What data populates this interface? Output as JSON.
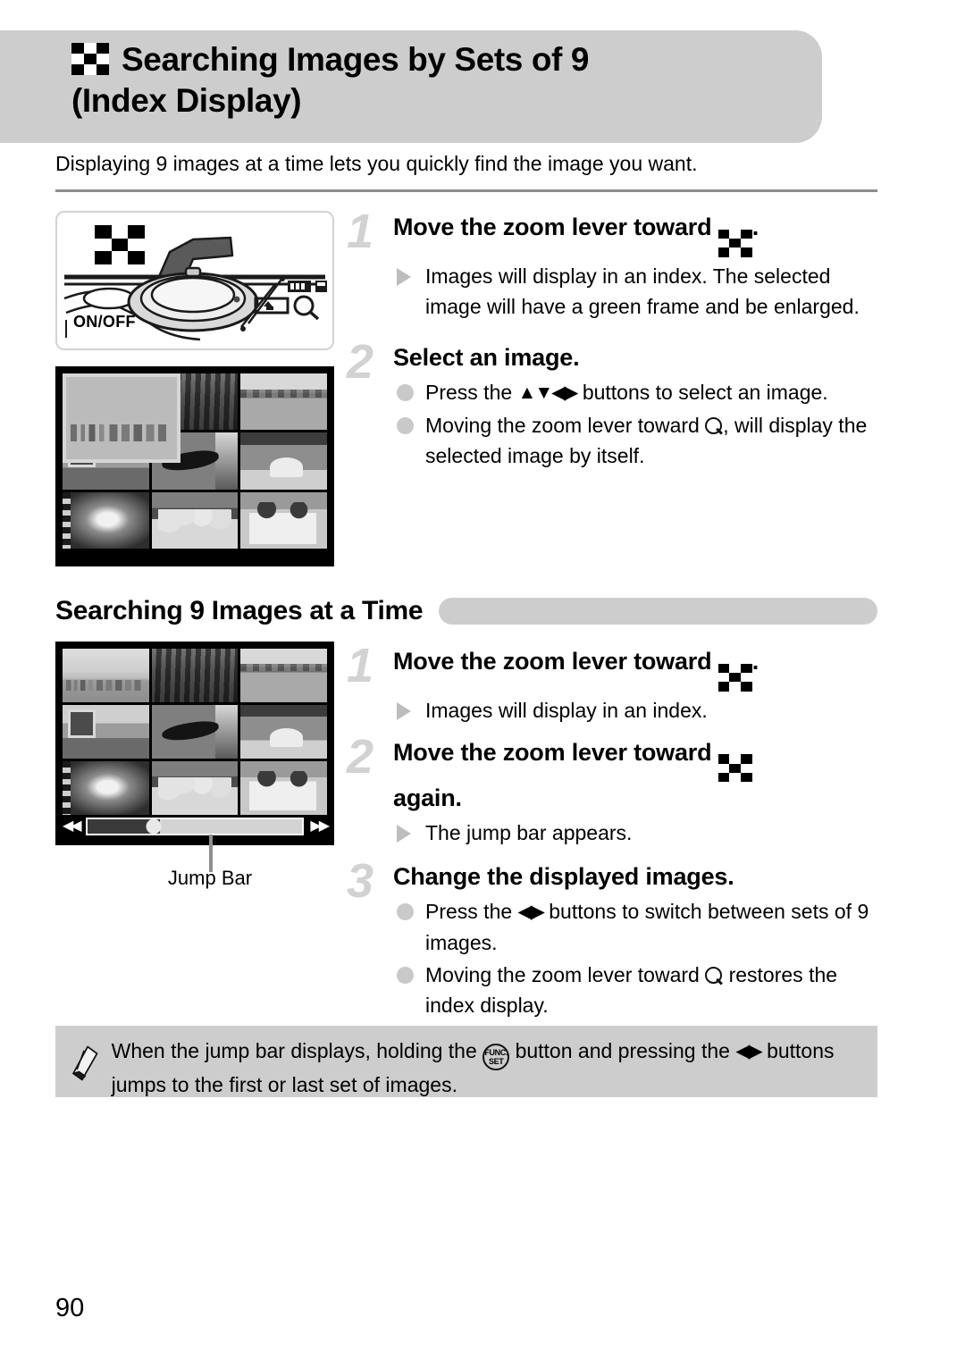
{
  "header": {
    "icon": "checkerboard-index-icon",
    "title_line1": "Searching Images by Sets of 9",
    "title_line2": "(Index Display)",
    "band_color": "#cdcdcd"
  },
  "intro": "Displaying 9 images at a time lets you quickly find the image you want.",
  "camera_figure": {
    "name": "camera-top-zoom-lever-illustration",
    "onoff_label": "ON/OFF",
    "icons": [
      "checkerboard-index-icon",
      "arrow-icon",
      "zoom-lever-icon",
      "magnifier-icon",
      "wide-icon",
      "tele-icon"
    ]
  },
  "index_display_1": {
    "name": "index-display-9-images",
    "selected_index": 0,
    "thumbnails": [
      "city-skyline",
      "forest-path",
      "lake-shore",
      "museum-room",
      "hammock",
      "dining-room",
      "dog-film",
      "girls-group",
      "family-portrait"
    ]
  },
  "steps_top": [
    {
      "number": "1",
      "heading_before": "Move the zoom lever toward",
      "heading_icon": "checkerboard-index-icon",
      "heading_after": ".",
      "bullets": [
        {
          "marker": "triangle",
          "text": "Images will display in an index. The selected image will have a green frame and be enlarged."
        }
      ]
    },
    {
      "number": "2",
      "heading_before": "Select an image.",
      "heading_icon": "",
      "heading_after": "",
      "bullets": [
        {
          "marker": "dot",
          "text_before": "Press the",
          "icon": "updown-leftright-arrows",
          "text_after": "buttons to select an image."
        },
        {
          "marker": "dot",
          "text_before": "Moving the zoom lever toward",
          "icon": "magnifier-icon",
          "text_after": ", will display the selected image by itself."
        }
      ]
    }
  ],
  "section": {
    "title": "Searching 9 Images at a Time",
    "bar_color": "#cdcdcd"
  },
  "index_display_2": {
    "name": "index-display-with-jump-bar",
    "jump_bar": {
      "left_arrow": "double-left-arrow-icon",
      "right_arrow": "double-right-arrow-icon",
      "fill_percent": 34,
      "handle_percent": 31
    },
    "callout_label": "Jump Bar"
  },
  "steps_bottom": [
    {
      "number": "1",
      "heading_before": "Move the zoom lever toward",
      "heading_icon": "checkerboard-index-icon",
      "heading_after": ".",
      "bullets": [
        {
          "marker": "triangle",
          "text": "Images will display in an index."
        }
      ]
    },
    {
      "number": "2",
      "heading_before": "Move the zoom lever toward",
      "heading_icon": "checkerboard-index-icon",
      "heading_after": "again.",
      "bullets": [
        {
          "marker": "triangle",
          "text": "The jump bar appears."
        }
      ]
    },
    {
      "number": "3",
      "heading_before": "Change the displayed images.",
      "heading_icon": "",
      "heading_after": "",
      "bullets": [
        {
          "marker": "dot",
          "text_before": "Press the",
          "icon": "leftright-arrows",
          "text_after": "buttons to switch between sets of 9 images."
        },
        {
          "marker": "dot",
          "text_before": "Moving the zoom lever toward",
          "icon": "magnifier-icon",
          "text_after": "restores the index display."
        }
      ]
    }
  ],
  "note": {
    "icon": "pencil-icon",
    "text_1": "When the jump bar displays, holding the",
    "func_top": "FUNC.",
    "func_bottom": "SET",
    "text_2": "button and pressing the",
    "arrows": "leftright-arrows",
    "text_3": "buttons jumps to the first or last set of images."
  },
  "page_number": "90"
}
